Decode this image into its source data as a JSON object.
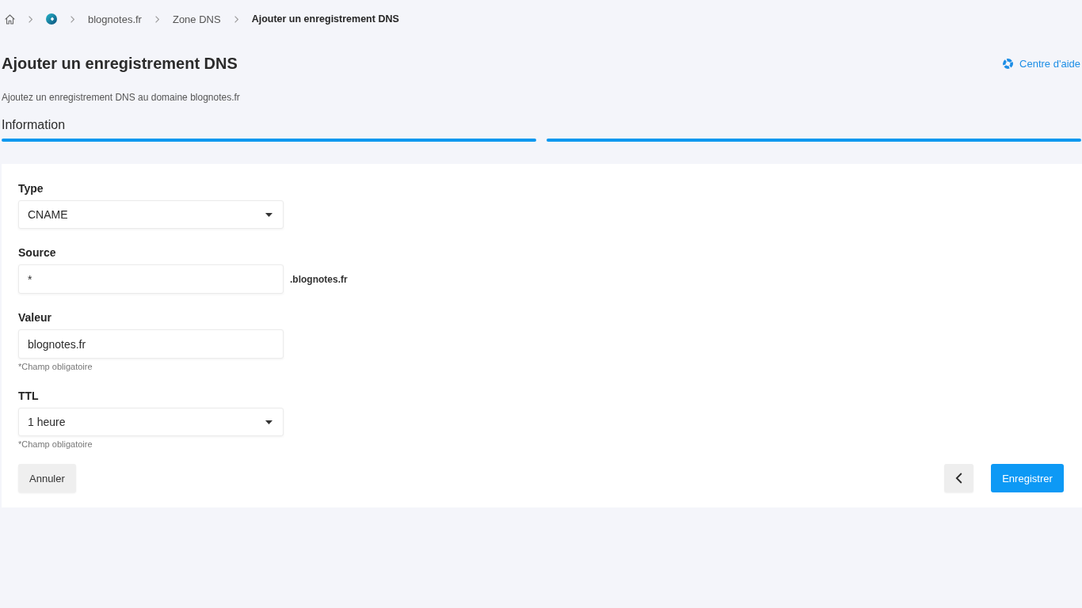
{
  "breadcrumb": {
    "items": [
      {
        "kind": "home"
      },
      {
        "kind": "logo"
      },
      {
        "kind": "link",
        "label": "blognotes.fr"
      },
      {
        "kind": "link",
        "label": "Zone DNS"
      },
      {
        "kind": "current",
        "label": "Ajouter un enregistrement DNS"
      }
    ]
  },
  "header": {
    "title": "Ajouter un enregistrement DNS",
    "help_link": "Centre d'aide",
    "subtitle": "Ajoutez un enregistrement DNS au domaine blognotes.fr"
  },
  "stepper": {
    "steps": [
      {
        "label": "Information",
        "complete": true
      },
      {
        "complete": true
      }
    ]
  },
  "form": {
    "fields": [
      {
        "kind": "select",
        "label": "Type",
        "value": "CNAME"
      },
      {
        "kind": "text",
        "label": "Source",
        "value": "*",
        "suffix": ".blognotes.fr"
      },
      {
        "kind": "text",
        "label": "Valeur",
        "value": "blognotes.fr",
        "hint": "*Champ obligatoire"
      },
      {
        "kind": "select",
        "label": "TTL",
        "value": "1 heure",
        "hint": "*Champ obligatoire"
      }
    ],
    "actions": {
      "cancel": "Annuler",
      "save": "Enregistrer"
    }
  }
}
